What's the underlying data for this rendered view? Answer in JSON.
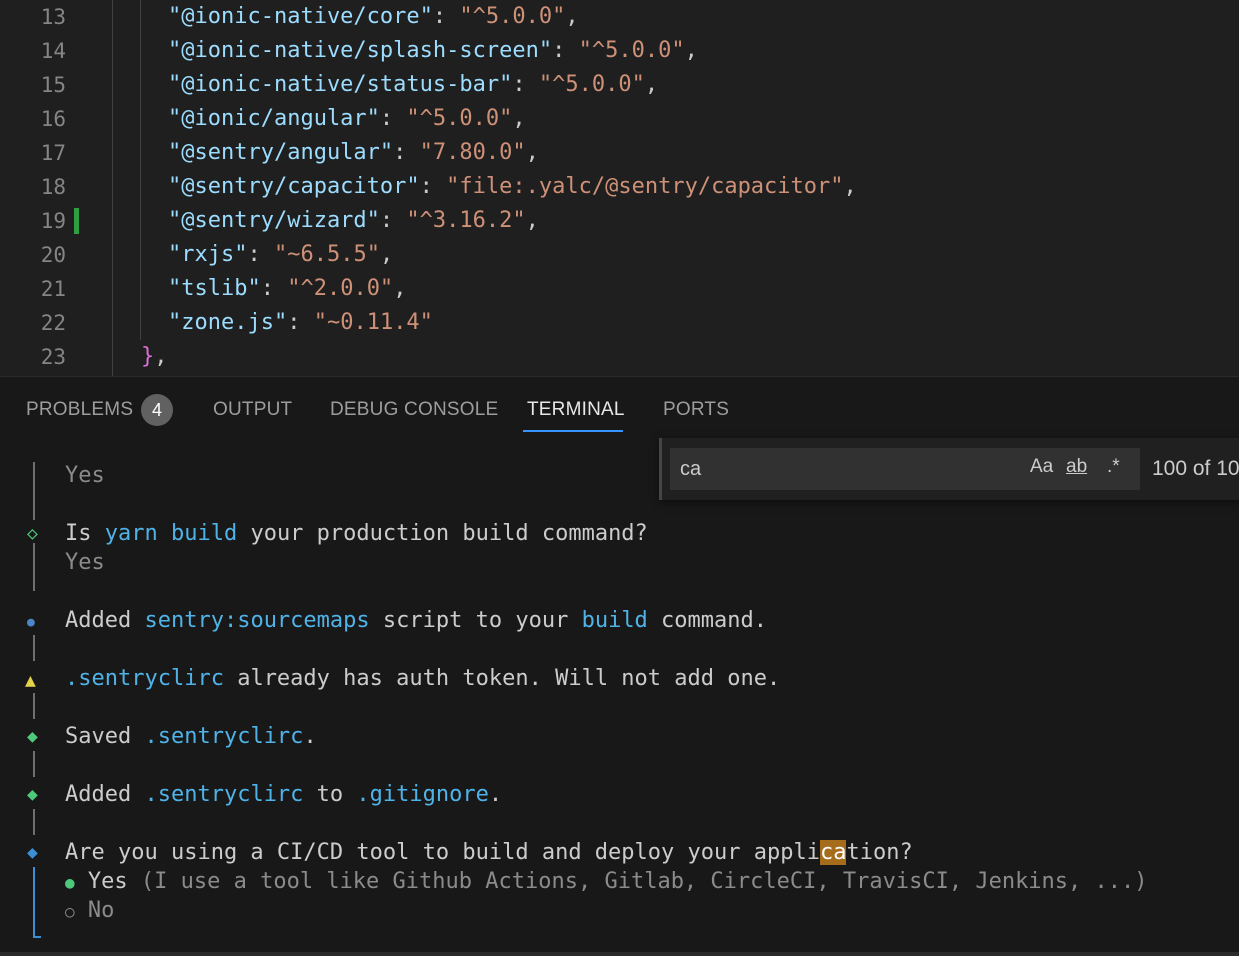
{
  "editor": {
    "lines": [
      {
        "num": "13",
        "key": "\"@ionic-native/core\"",
        "val": "\"^5.0.0\"",
        "end": ","
      },
      {
        "num": "14",
        "key": "\"@ionic-native/splash-screen\"",
        "val": "\"^5.0.0\"",
        "end": ","
      },
      {
        "num": "15",
        "key": "\"@ionic-native/status-bar\"",
        "val": "\"^5.0.0\"",
        "end": ","
      },
      {
        "num": "16",
        "key": "\"@ionic/angular\"",
        "val": "\"^5.0.0\"",
        "end": ","
      },
      {
        "num": "17",
        "key": "\"@sentry/angular\"",
        "val": "\"7.80.0\"",
        "end": ","
      },
      {
        "num": "18",
        "key": "\"@sentry/capacitor\"",
        "val": "\"file:.yalc/@sentry/capacitor\"",
        "end": ","
      },
      {
        "num": "19",
        "key": "\"@sentry/wizard\"",
        "val": "\"^3.16.2\"",
        "end": ","
      },
      {
        "num": "20",
        "key": "\"rxjs\"",
        "val": "\"~6.5.5\"",
        "end": ","
      },
      {
        "num": "21",
        "key": "\"tslib\"",
        "val": "\"^2.0.0\"",
        "end": ","
      },
      {
        "num": "22",
        "key": "\"zone.js\"",
        "val": "\"~0.11.4\"",
        "end": ""
      }
    ],
    "last_line_num": "23",
    "last_line_brace": "}",
    "last_line_comma": ",",
    "colon": ": "
  },
  "panel": {
    "tabs": {
      "problems": "PROBLEMS",
      "problems_count": "4",
      "output": "OUTPUT",
      "debug_console": "DEBUG CONSOLE",
      "terminal": "TERMINAL",
      "ports": "PORTS"
    },
    "active_tab": "TERMINAL"
  },
  "find": {
    "value": "ca",
    "match_case": "Aa",
    "whole_word": "ab",
    "regex": ".*",
    "count": "100 of 10"
  },
  "terminal": {
    "l1": "Yes",
    "l2a": "Is ",
    "l2b": "yarn build",
    "l2c": " your production build command?",
    "l3": "Yes",
    "l4a": "Added ",
    "l4b": "sentry:sourcemaps",
    "l4c": " script to your ",
    "l4d": "build",
    "l4e": " command.",
    "l5a": ".sentryclirc",
    "l5b": " already has auth token. Will not add one.",
    "l6a": "Saved ",
    "l6b": ".sentryclirc",
    "l6c": ".",
    "l7a": "Added ",
    "l7b": ".sentryclirc",
    "l7c": " to ",
    "l7d": ".gitignore",
    "l7e": ".",
    "l8a": "Are you using a CI/CD tool to build and deploy your appli",
    "l8b": "ca",
    "l8c": "tion?",
    "opt1_bullet": "●",
    "opt1_label": "Yes",
    "opt1_hint": " (I use a tool like Github Actions, Gitlab, CircleCI, TravisCI, Jenkins, ...)",
    "opt2_bullet": "○",
    "opt2_label": "No",
    "symbols": {
      "diamond_outline": "◇",
      "dot": "●",
      "warning": "▲",
      "diamond": "◆"
    },
    "colors": {
      "green": "#4ec97b",
      "blue": "#4d86c8",
      "yellow": "#e4d34a",
      "active_blue": "#3b8fd6"
    }
  }
}
